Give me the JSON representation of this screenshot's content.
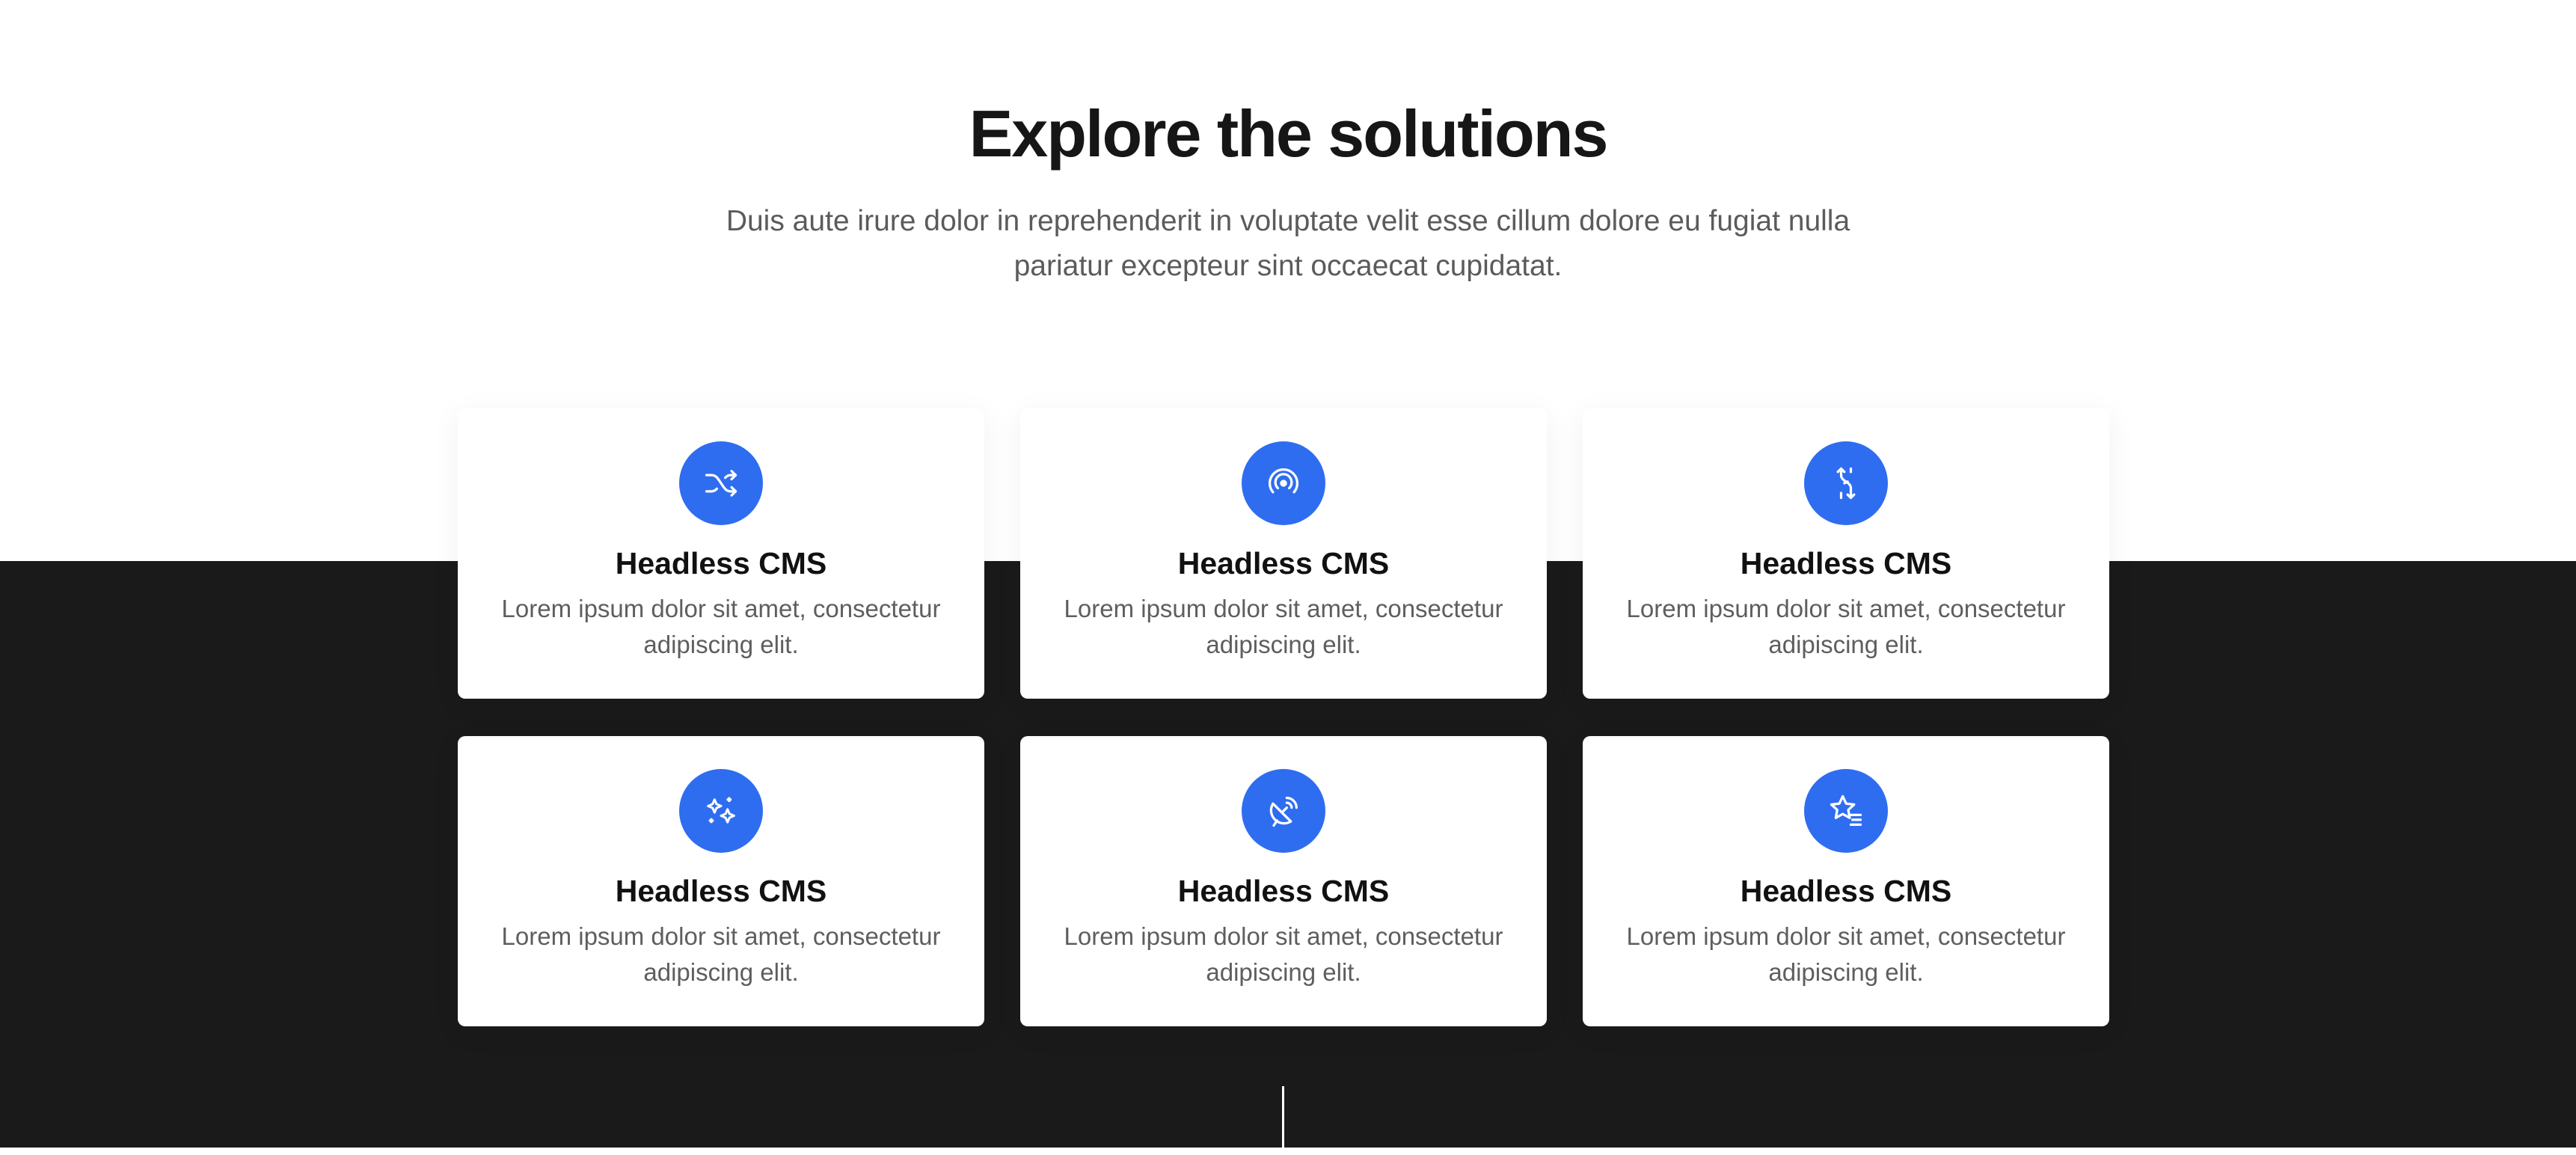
{
  "section": {
    "title": "Explore the solutions",
    "subtitle": "Duis aute irure dolor in reprehenderit in voluptate velit esse cillum dolore eu fugiat nulla pariatur excepteur sint occaecat cupidatat."
  },
  "cards": [
    {
      "icon": "shuffle-icon",
      "title": "Headless CMS",
      "description": "Lorem ipsum dolor sit amet, consectetur adipiscing elit."
    },
    {
      "icon": "target-icon",
      "title": "Headless CMS",
      "description": "Lorem ipsum dolor sit amet, consectetur adipiscing elit."
    },
    {
      "icon": "split-arrows-icon",
      "title": "Headless CMS",
      "description": "Lorem ipsum dolor sit amet, consectetur adipiscing elit."
    },
    {
      "icon": "sparkles-icon",
      "title": "Headless CMS",
      "description": "Lorem ipsum dolor sit amet, consectetur adipiscing elit."
    },
    {
      "icon": "satellite-dish-icon",
      "title": "Headless CMS",
      "description": "Lorem ipsum dolor sit amet, consectetur adipiscing elit."
    },
    {
      "icon": "star-list-icon",
      "title": "Headless CMS",
      "description": "Lorem ipsum dolor sit amet, consectetur adipiscing elit."
    }
  ],
  "colors": {
    "accent": "#2f6df0",
    "dark_background": "#1a1a1a",
    "heading": "#161616",
    "body_text": "#5e5e5e"
  }
}
